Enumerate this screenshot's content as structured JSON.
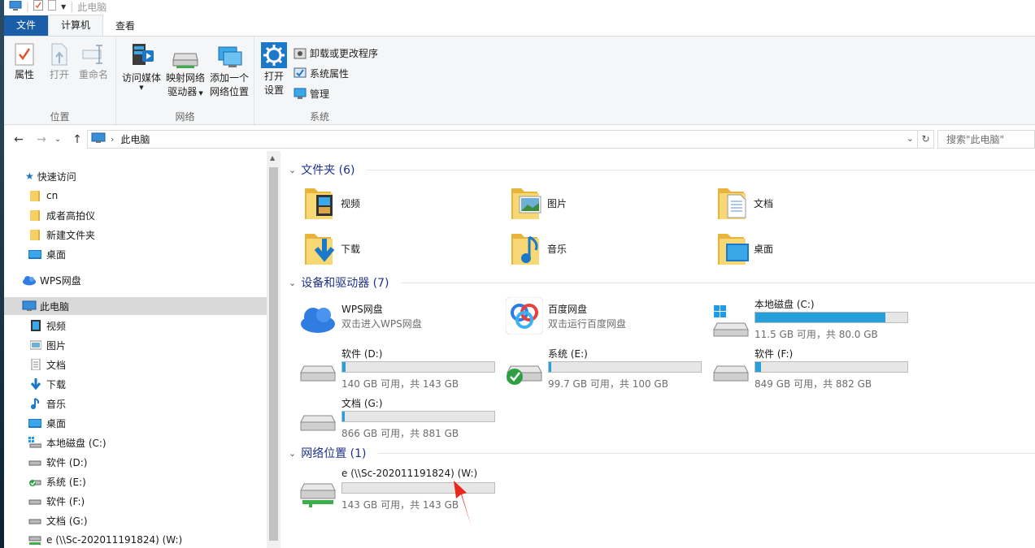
{
  "window": {
    "title": "此电脑"
  },
  "ribbon": {
    "tabs": [
      "文件",
      "计算机",
      "查看"
    ],
    "groups": {
      "location": {
        "label": "位置",
        "properties": "属性",
        "open": "打开",
        "rename": "重命名"
      },
      "network": {
        "label": "网络",
        "access_media": "访问媒体",
        "map_drive_1": "映射网络",
        "map_drive_2": "驱动器",
        "add_loc_1": "添加一个",
        "add_loc_2": "网络位置"
      },
      "system": {
        "label": "系统",
        "open_settings_1": "打开",
        "open_settings_2": "设置",
        "uninstall": "卸载或更改程序",
        "sys_props": "系统属性",
        "manage": "管理"
      }
    }
  },
  "address": {
    "path": "此电脑",
    "search_placeholder": "搜索\"此电脑\""
  },
  "nav": {
    "quick_access": "快速访问",
    "quick_items": [
      "cn",
      "成者高拍仪",
      "新建文件夹",
      "桌面"
    ],
    "wps": "WPS网盘",
    "this_pc": "此电脑",
    "pc_items": [
      "视频",
      "图片",
      "文档",
      "下载",
      "音乐",
      "桌面",
      "本地磁盘 (C:)",
      "软件 (D:)",
      "系统 (E:)",
      "软件 (F:)",
      "文档 (G:)",
      "e (\\\\Sc-202011191824) (W:)"
    ]
  },
  "sections": {
    "folders": "文件夹 (6)",
    "devices": "设备和驱动器 (7)",
    "network": "网络位置 (1)"
  },
  "folders": [
    "视频",
    "图片",
    "文档",
    "下载",
    "音乐",
    "桌面"
  ],
  "cloud": [
    {
      "name": "WPS网盘",
      "desc": "双击进入WPS网盘"
    },
    {
      "name": "百度网盘",
      "desc": "双击运行百度网盘"
    }
  ],
  "drives": [
    {
      "name": "本地磁盘 (C:)",
      "free": "11.5 GB 可用，共 80.0 GB",
      "used": 0.856
    },
    {
      "name": "软件 (D:)",
      "free": "140 GB 可用，共 143 GB",
      "used": 0.021
    },
    {
      "name": "系统 (E:)",
      "free": "99.7 GB 可用，共 100 GB",
      "used": 0.003
    },
    {
      "name": "软件 (F:)",
      "free": "849 GB 可用，共 882 GB",
      "used": 0.037
    },
    {
      "name": "文档 (G:)",
      "free": "866 GB 可用，共 881 GB",
      "used": 0.017
    }
  ],
  "network_drive": {
    "name": "e (\\\\Sc-202011191824) (W:)",
    "free": "143 GB 可用，共 143 GB",
    "used": 0.0
  },
  "colors": {
    "accent": "#1a5da8",
    "bar": "#26a0da",
    "section": "#1e3287",
    "annotation_arrow": "#e8281e"
  }
}
